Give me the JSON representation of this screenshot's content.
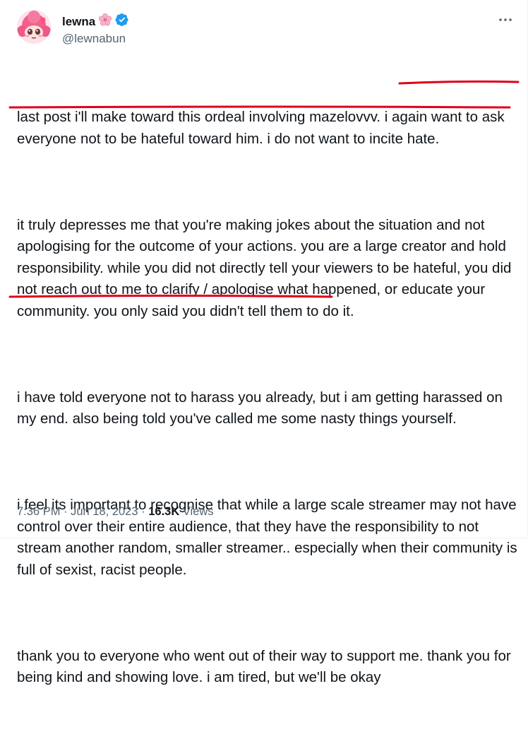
{
  "author": {
    "name": "lewna",
    "handle": "@lewnabun",
    "verified_icon": "verified-badge-icon",
    "name_emoji": "cherry-blossom-icon"
  },
  "tweet": {
    "paragraphs": [
      "last post i'll make toward this ordeal involving mazelovvv. i again want to ask everyone not to be hateful toward him. i do not want to incite hate.",
      "it truly depresses me that you're making jokes about the situation and not apologising for the outcome of your actions. you are a large creator and hold responsibility. while you did not directly tell your viewers to be hateful, you did not reach out to me to clarify / apologise what happened, or educate your community. you only said you didn't tell them to do it.",
      "i have told everyone not to harass you already, but i am getting harassed on my end. also being told you've called me some nasty things yourself.",
      "i feel its important to recognise that while a large scale streamer may not have control over their entire audience, that they have the responsibility to not stream another random, smaller streamer.. especially when their community is full of sexist, racist people.",
      "thank you to everyone who went out of their way to support me. thank you for being kind and showing love. i am tired, but we'll be okay"
    ]
  },
  "meta": {
    "time": "7:36 PM",
    "sep1": " · ",
    "date": "Jun 18, 2023",
    "sep2": " · ",
    "views_count": "16.3K",
    "views_label": " Views"
  },
  "colors": {
    "text": "#0f1419",
    "secondary": "#536471",
    "verified": "#1d9bf0",
    "annotation": "#e0001b"
  }
}
